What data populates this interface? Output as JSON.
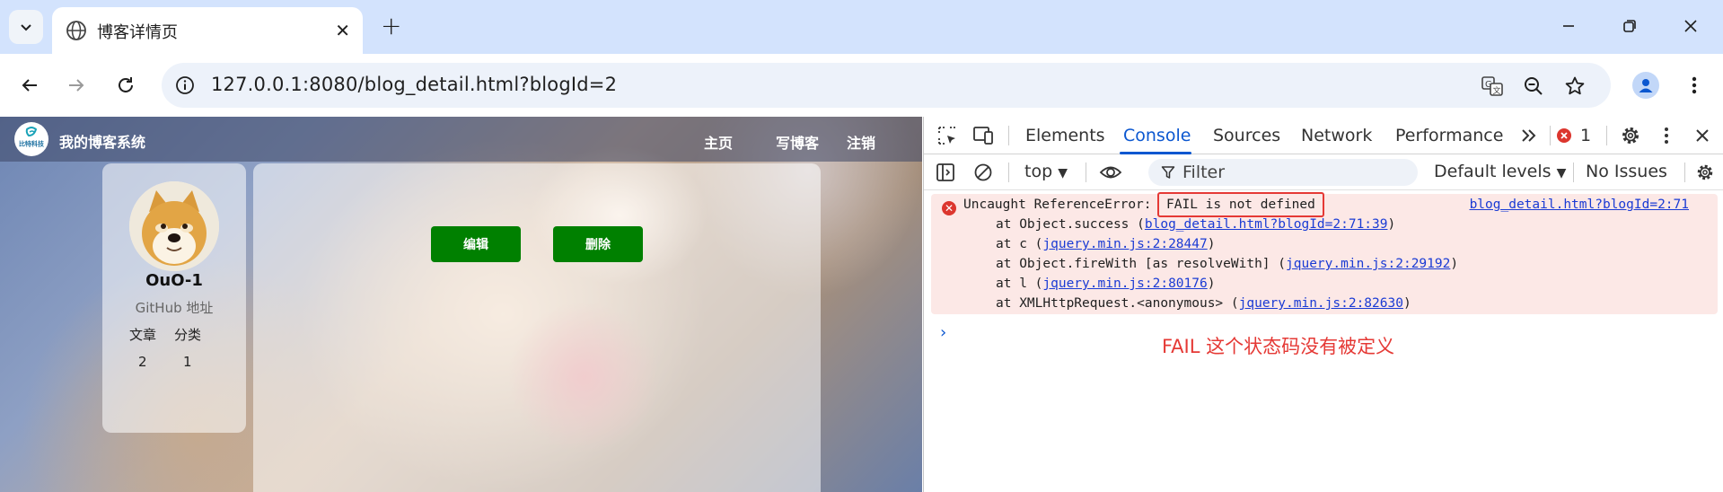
{
  "browser": {
    "tab_title": "博客详情页",
    "url": "127.0.0.1:8080/blog_detail.html?blogId=2"
  },
  "site": {
    "title": "我的博客系统",
    "logo_text": "比特科技",
    "nav": [
      "主页",
      "写博客",
      "注销"
    ]
  },
  "profile": {
    "name": "OuO-1",
    "github": "GitHub 地址",
    "stat_labels": [
      "文章",
      "分类"
    ],
    "stat_values": [
      "2",
      "1"
    ]
  },
  "content": {
    "edit_label": "编辑",
    "delete_label": "删除"
  },
  "devtools": {
    "tabs": [
      "Elements",
      "Console",
      "Sources",
      "Network",
      "Performance"
    ],
    "active_tab": "Console",
    "error_count": "1",
    "context": "top",
    "filter_placeholder": "Filter",
    "levels": "Default levels",
    "issues": "No Issues",
    "error": {
      "prefix": "Uncaught ReferenceError:",
      "message": "FAIL is not defined",
      "source": "blog_detail.html?blogId=2:71",
      "stack": [
        {
          "pre": "at Object.success (",
          "link": "blog_detail.html?blogId=2:71:39",
          "post": ")"
        },
        {
          "pre": "at c (",
          "link": "jquery.min.js:2:28447",
          "post": ")"
        },
        {
          "pre": "at Object.fireWith [as resolveWith] (",
          "link": "jquery.min.js:2:29192",
          "post": ")"
        },
        {
          "pre": "at l (",
          "link": "jquery.min.js:2:80176",
          "post": ")"
        },
        {
          "pre": "at XMLHttpRequest.<anonymous> (",
          "link": "jquery.min.js:2:82630",
          "post": ")"
        }
      ]
    },
    "annotation": "FAIL 这个状态码没有被定义"
  },
  "colors": {
    "accent": "#0b57d0",
    "error_bg": "#fce8e6",
    "error_red": "#dc362e",
    "annotation_red": "#e53935",
    "button_green": "#008000"
  }
}
